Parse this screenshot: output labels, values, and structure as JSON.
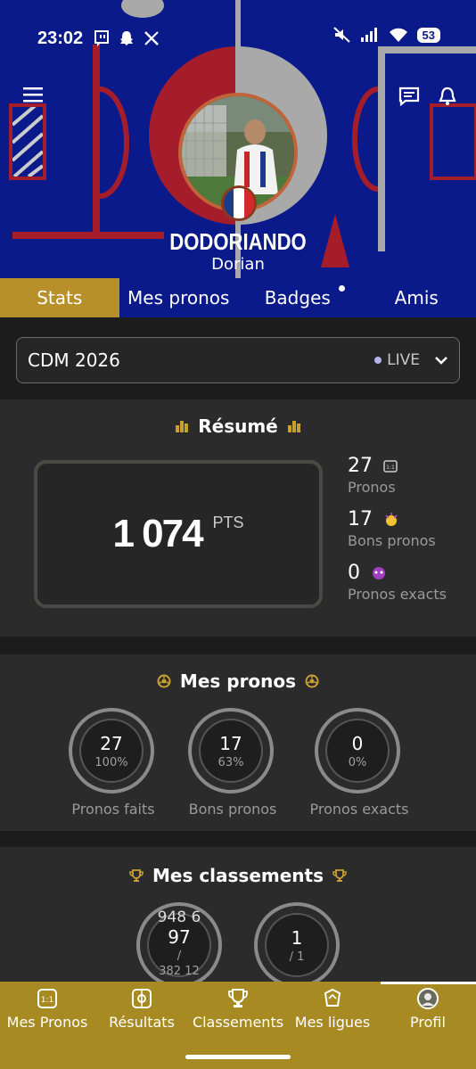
{
  "status_bar": {
    "time": "23:02",
    "battery": "53"
  },
  "profile": {
    "username": "DODORIANDO",
    "name": "Dorian"
  },
  "tabs": [
    {
      "label": "Stats"
    },
    {
      "label": "Mes pronos"
    },
    {
      "label": "Badges"
    },
    {
      "label": "Amis"
    }
  ],
  "competition": {
    "selected": "CDM 2026",
    "live_label": "LIVE"
  },
  "resume": {
    "title": "Résumé",
    "points_value": "1 074",
    "points_unit": "PTS",
    "stats": [
      {
        "value": "27",
        "label": "Pronos"
      },
      {
        "value": "17",
        "label": "Bons pronos"
      },
      {
        "value": "0",
        "label": "Pronos exacts"
      }
    ]
  },
  "mes_pronos": {
    "title": "Mes pronos",
    "circles": [
      {
        "value": "27",
        "percent": "100%",
        "label": "Pronos faits",
        "fill": 1.0
      },
      {
        "value": "17",
        "percent": "63%",
        "label": "Bons pronos",
        "fill": 0.63
      },
      {
        "value": "0",
        "percent": "0%",
        "label": "Pronos exacts",
        "fill": 0.0
      }
    ]
  },
  "classements": {
    "title": "Mes classements",
    "circles": [
      {
        "top": "948 6",
        "value": "97",
        "sub": "/",
        "bottom": "382 12"
      },
      {
        "value": "1",
        "sub": "/ 1"
      }
    ]
  },
  "bottom_nav": [
    {
      "label": "Mes Pronos",
      "icon": "match-card-icon"
    },
    {
      "label": "Résultats",
      "icon": "results-icon"
    },
    {
      "label": "Classements",
      "icon": "trophy-icon"
    },
    {
      "label": "Mes ligues",
      "icon": "league-icon"
    },
    {
      "label": "Profil",
      "icon": "profile-avatar-icon"
    }
  ],
  "colors": {
    "header_blue": "#0b1a8a",
    "gold": "#b8902a",
    "red": "#a51d2a",
    "dark": "#2b2b2b"
  }
}
